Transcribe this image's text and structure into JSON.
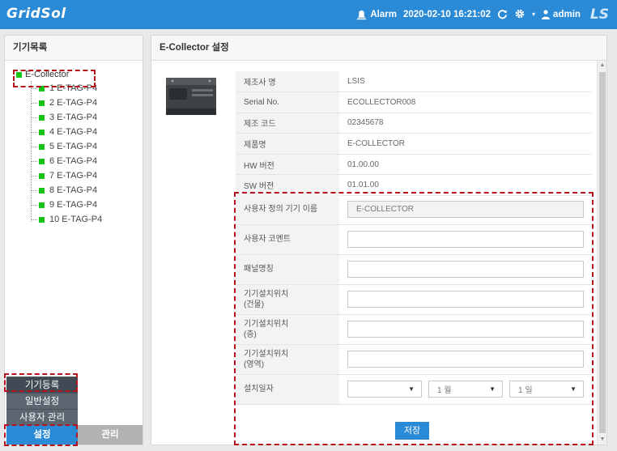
{
  "header": {
    "logo": "GridSol",
    "alarm_label": "Alarm",
    "datetime": "2020-02-10 16:21:02",
    "user": "admin",
    "brand_logo": "LS"
  },
  "sidebar": {
    "title": "기기목록",
    "root": "E-Collector",
    "devices": [
      "1 E-TAG-P4",
      "2 E-TAG-P4",
      "3 E-TAG-P4",
      "4 E-TAG-P4",
      "5 E-TAG-P4",
      "6 E-TAG-P4",
      "7 E-TAG-P4",
      "8 E-TAG-P4",
      "9 E-TAG-P4",
      "10 E-TAG-P4"
    ],
    "menu": [
      "기기등록",
      "일반설정",
      "사용자 관리"
    ],
    "tabs": {
      "active": "설정",
      "inactive": "관리"
    }
  },
  "main": {
    "title": "E-Collector 설정",
    "info": [
      {
        "label": "제조사 명",
        "value": "LSIS"
      },
      {
        "label": "Serial No.",
        "value": "ECOLLECTOR008"
      },
      {
        "label": "제조 코드",
        "value": "02345678"
      },
      {
        "label": "제품명",
        "value": "E-COLLECTOR"
      },
      {
        "label": "HW 버전",
        "value": "01.00.00"
      },
      {
        "label": "SW 버전",
        "value": "01.01.00"
      }
    ],
    "form": {
      "user_device_name_label": "사용자 정의 기기 이름",
      "user_device_name_value": "E-COLLECTOR",
      "user_comment_label": "사용자 코멘트",
      "panel_name_label": "패널명칭",
      "loc_building_label1": "기기설치위치",
      "loc_building_label2": "(건물)",
      "loc_floor_label1": "기기설치위치",
      "loc_floor_label2": "(층)",
      "loc_area_label1": "기기설치위치",
      "loc_area_label2": "(영역)",
      "install_date_label": "설치일자",
      "year_value": "",
      "month_value": "1 월",
      "day_value": "1 일"
    },
    "save_label": "저장"
  },
  "colors": {
    "topbar": "#2b8ad6",
    "status_green": "#16c416",
    "highlight_dash": "#b5121b"
  }
}
